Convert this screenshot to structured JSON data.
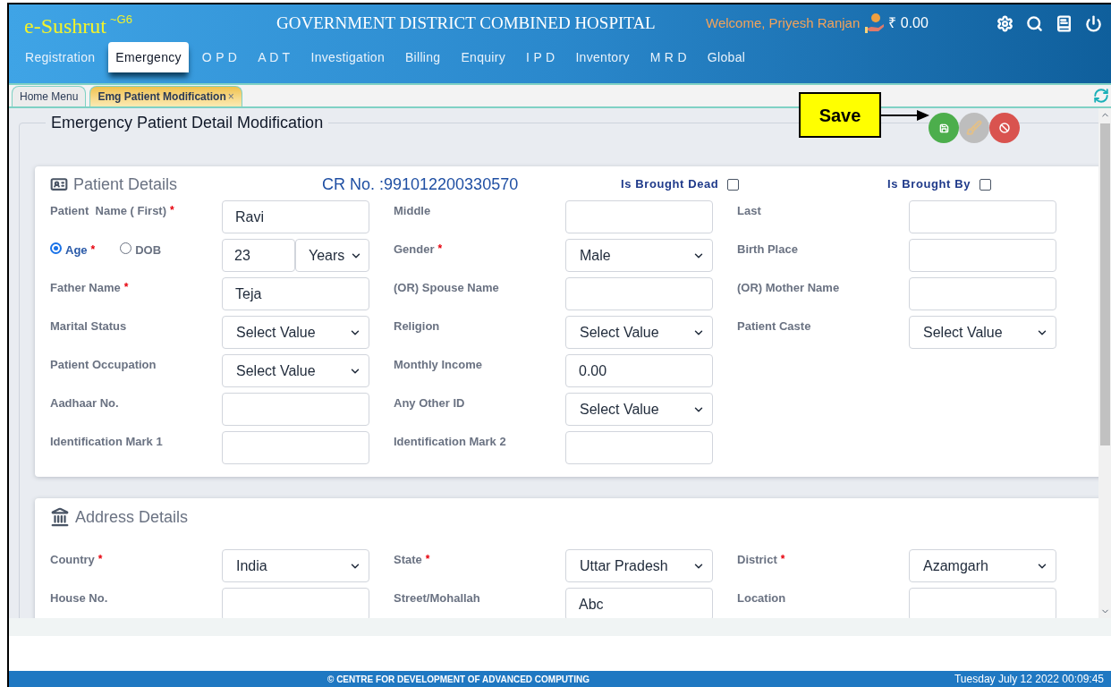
{
  "header": {
    "logo": "e-Sushrut",
    "logo_sup": "~G6",
    "title": "GOVERNMENT DISTRICT COMBINED HOSPITAL",
    "welcome": "Welcome, Priyesh Ranjan",
    "balance": "₹ 0.00"
  },
  "nav": [
    {
      "label": "Registration",
      "selected": false
    },
    {
      "label": "Emergency",
      "selected": true
    },
    {
      "label": "O P D",
      "selected": false
    },
    {
      "label": "A D T",
      "selected": false
    },
    {
      "label": "Investigation",
      "selected": false
    },
    {
      "label": "Billing",
      "selected": false
    },
    {
      "label": "Enquiry",
      "selected": false
    },
    {
      "label": "I P D",
      "selected": false
    },
    {
      "label": "Inventory",
      "selected": false
    },
    {
      "label": "M R D",
      "selected": false
    },
    {
      "label": "Global",
      "selected": false
    }
  ],
  "page_tabs": [
    {
      "label": "Home Menu",
      "selected": false
    },
    {
      "label": "Emg Patient Modification",
      "selected": true,
      "close": "×"
    }
  ],
  "panel_title": "Emergency Patient Detail Modification",
  "callout": "Save",
  "patient_details": {
    "title": "Patient Details",
    "cr_no": "CR No. :991012200330570",
    "flags": [
      {
        "label": "Is Brought Dead",
        "checked": false
      },
      {
        "label": "Is Brought By",
        "checked": false
      }
    ],
    "rows": [
      [
        {
          "kind": "field",
          "label": "Patient  Name ( First)",
          "required_mark": "*",
          "control": {
            "kind": "text",
            "value": "Ravi"
          }
        },
        {
          "kind": "field",
          "label": "Middle",
          "control": {
            "kind": "text"
          }
        },
        {
          "kind": "field",
          "label": "Last",
          "control": {
            "kind": "text"
          }
        }
      ],
      [
        {
          "kind": "age",
          "options": [
            {
              "label": "Age",
              "required_mark": "*",
              "selected": true
            },
            {
              "label": "DOB",
              "selected": false
            }
          ],
          "value": "23",
          "unit": "Years"
        },
        {
          "kind": "field",
          "label": "Gender",
          "required_mark": "*",
          "control": {
            "kind": "select",
            "value": "Male"
          }
        },
        {
          "kind": "field",
          "label": "Birth Place",
          "control": {
            "kind": "text"
          }
        }
      ],
      [
        {
          "kind": "field",
          "label": "Father Name",
          "required_mark": "*",
          "control": {
            "kind": "text",
            "value": "Teja"
          }
        },
        {
          "kind": "field",
          "label": "(OR) Spouse Name",
          "control": {
            "kind": "text"
          }
        },
        {
          "kind": "field",
          "label": "(OR) Mother Name",
          "control": {
            "kind": "text"
          }
        }
      ],
      [
        {
          "kind": "field",
          "label": "Marital Status",
          "control": {
            "kind": "select",
            "value": "Select Value"
          }
        },
        {
          "kind": "field",
          "label": "Religion",
          "control": {
            "kind": "select",
            "value": "Select Value"
          }
        },
        {
          "kind": "field",
          "label": "Patient Caste",
          "control": {
            "kind": "select",
            "value": "Select Value"
          }
        }
      ],
      [
        {
          "kind": "field",
          "label": "Patient Occupation",
          "control": {
            "kind": "select",
            "value": "Select Value"
          }
        },
        {
          "kind": "field",
          "label": "Monthly Income",
          "control": {
            "kind": "text",
            "value": "0.00"
          }
        }
      ],
      [
        {
          "kind": "field",
          "label": "Aadhaar No.",
          "control": {
            "kind": "text"
          }
        },
        {
          "kind": "field",
          "label": "Any Other ID",
          "control": {
            "kind": "select",
            "value": "Select Value"
          }
        }
      ],
      [
        {
          "kind": "field",
          "label": "Identification Mark 1",
          "control": {
            "kind": "text"
          }
        },
        {
          "kind": "field",
          "label": "Identification Mark 2",
          "control": {
            "kind": "text"
          }
        }
      ]
    ]
  },
  "address_details": {
    "title": "Address Details",
    "rows": [
      [
        {
          "kind": "field",
          "label": "Country",
          "required_mark": "*",
          "control": {
            "kind": "select",
            "value": "India"
          }
        },
        {
          "kind": "field",
          "label": "State",
          "required_mark": "*",
          "control": {
            "kind": "select",
            "value": "Uttar Pradesh"
          }
        },
        {
          "kind": "field",
          "label": "District",
          "required_mark": "*",
          "control": {
            "kind": "select",
            "value": "Azamgarh"
          }
        }
      ],
      [
        {
          "kind": "field",
          "label": "House No.",
          "control": {
            "kind": "text"
          }
        },
        {
          "kind": "field",
          "label": "Street/Mohallah",
          "control": {
            "kind": "text",
            "value": "Abc"
          }
        },
        {
          "kind": "field",
          "label": "Location",
          "control": {
            "kind": "text"
          }
        }
      ]
    ]
  },
  "footer": {
    "credit": "© CENTRE FOR DEVELOPMENT OF ADVANCED COMPUTING",
    "datetime": "Tuesday July 12 2022 00:09:45"
  }
}
